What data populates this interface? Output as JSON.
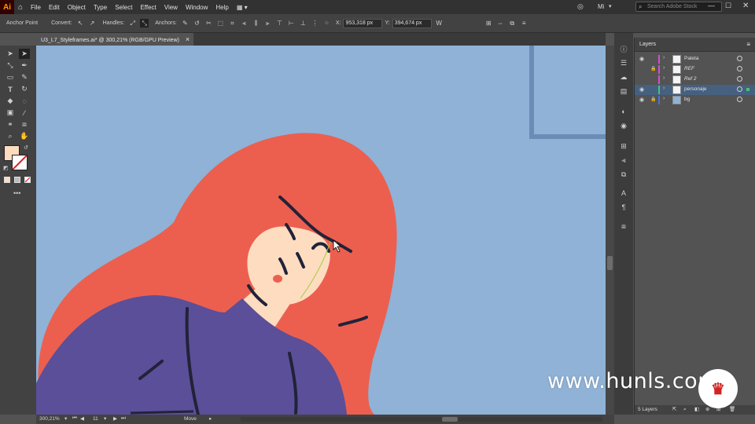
{
  "app": {
    "logo": "Ai",
    "menu": [
      "File",
      "Edit",
      "Object",
      "Type",
      "Select",
      "Effect",
      "View",
      "Window",
      "Help"
    ],
    "workspace": "Mi",
    "search_placeholder": "Search Adobe Stock"
  },
  "control_bar": {
    "selection_label": "Anchor Point",
    "convert_label": "Convert:",
    "handles_label": "Handles:",
    "anchors_label": "Anchors:",
    "x_value": "953,318 px",
    "y_value": "394,674 px"
  },
  "document": {
    "tab_title": "U3_L7_Styleframes.ai* @ 300,21% (RGB/GPU Preview)",
    "close_glyph": "×"
  },
  "colors": {
    "canvas_bg": "#8fb2d6",
    "hair": "#ec5f4f",
    "skin": "#fddcc0",
    "shirt": "#5a4f98",
    "ink": "#222239",
    "frame": "#6a8cb6",
    "fill_swatch": "#fddcc0"
  },
  "layers_panel": {
    "title": "Layers",
    "layers": [
      {
        "name": "Paleta",
        "color": "#d24fd0",
        "visible": true,
        "locked": false,
        "selected": false
      },
      {
        "name": "REF",
        "color": "#d24fd0",
        "visible": false,
        "locked": true,
        "selected": false
      },
      {
        "name": "Ref 2",
        "color": "#d24fd0",
        "visible": false,
        "locked": false,
        "selected": false
      },
      {
        "name": "personaje",
        "color": "#48c07b",
        "visible": true,
        "locked": false,
        "selected": true
      },
      {
        "name": "bg",
        "color": "#4a6fd8",
        "visible": true,
        "locked": true,
        "selected": false
      }
    ],
    "footer": "5 Layers"
  },
  "status_bar": {
    "zoom": "300,21%",
    "artboard": "11",
    "tool": "Move"
  },
  "watermark": {
    "text": "www.hunls.com"
  }
}
